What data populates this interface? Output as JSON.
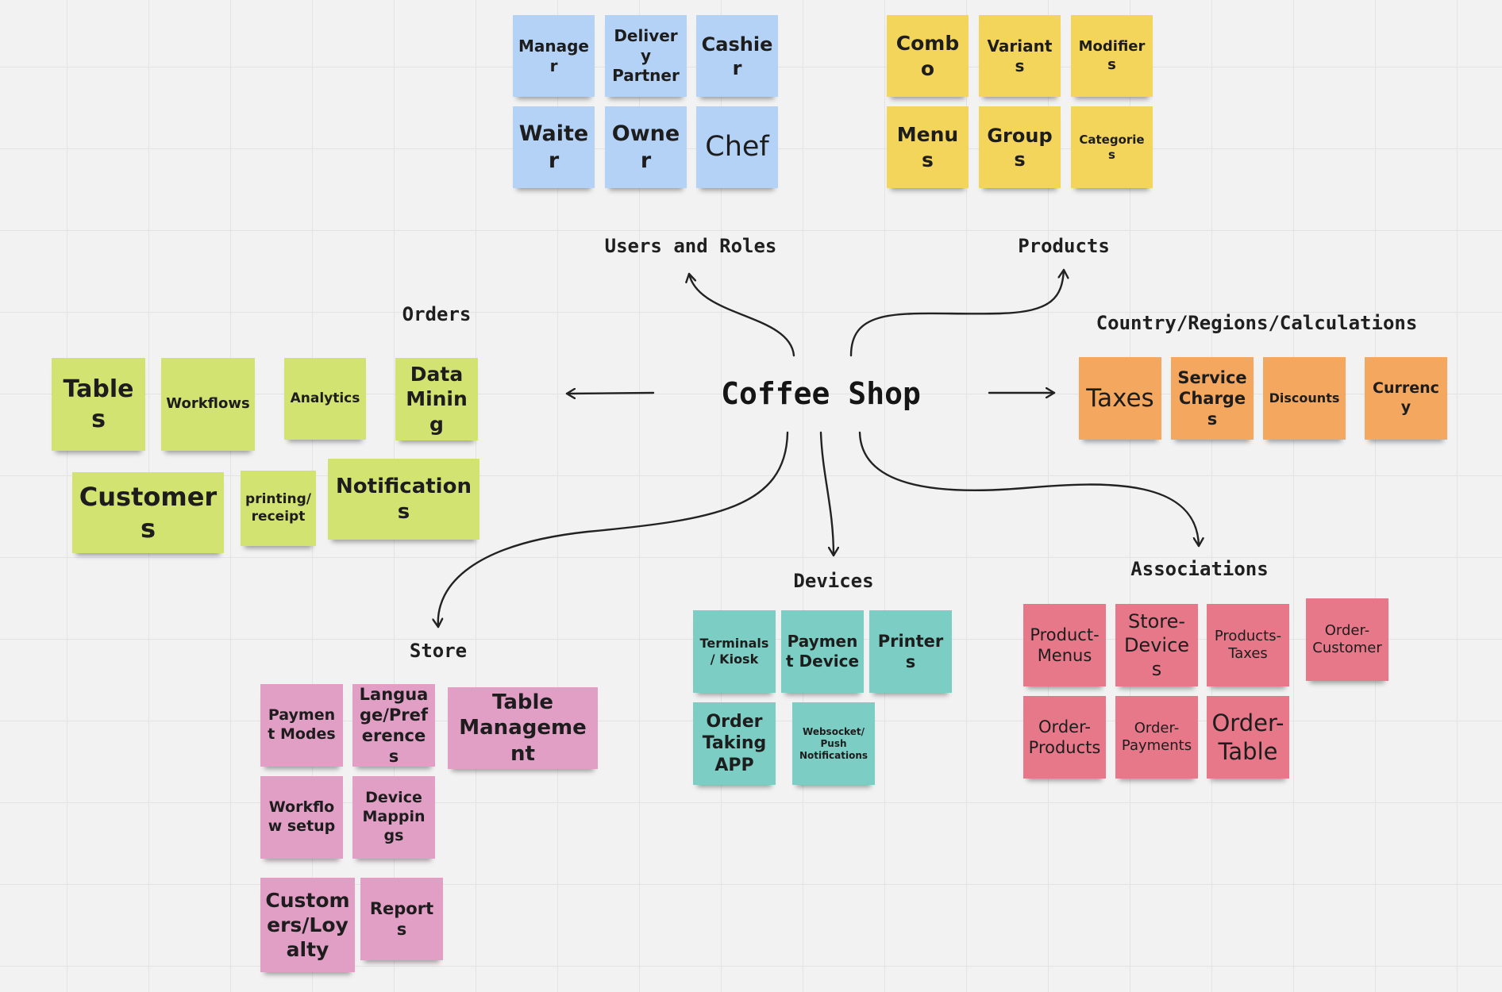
{
  "center": {
    "title": "Coffee Shop"
  },
  "groups": {
    "users_and_roles": {
      "label": "Users and Roles",
      "notes": [
        "Manager",
        "Delivery Partner",
        "Cashier",
        "Waiter",
        "Owner",
        "Chef"
      ]
    },
    "products": {
      "label": "Products",
      "notes": [
        "Combo",
        "Variants",
        "Modifiers",
        "Menus",
        "Groups",
        "Categories"
      ]
    },
    "orders": {
      "label": "Orders",
      "notes": [
        "Tables",
        "Workflows",
        "Analytics",
        "Data Mining",
        "Customers",
        "printing/ receipt",
        "Notifications"
      ]
    },
    "country": {
      "label": "Country/Regions/Calculations",
      "notes": [
        "Taxes",
        "Service Charges",
        "Discounts",
        "Currency"
      ]
    },
    "store": {
      "label": "Store",
      "notes": [
        "Payment Modes",
        "Langua ge/Pref erences",
        "Table Management",
        "Workflow setup",
        "Device Mappings",
        "Custom ers/Loy alty",
        "Reports"
      ]
    },
    "devices": {
      "label": "Devices",
      "notes": [
        "Terminals/ Kiosk",
        "Payment Device",
        "Printers",
        "Order Taking APP",
        "Websocket/ Push Notifications"
      ]
    },
    "associations": {
      "label": "Associations",
      "notes": [
        "Product-Menus",
        "Store-Devices",
        "Products-Taxes",
        "Order-Customer",
        "Order-Products",
        "Order-Payments",
        "Order-Table"
      ]
    }
  },
  "colors": {
    "blue": "#b4d2f6",
    "yellow": "#f3d55c",
    "green": "#d3e372",
    "orange": "#f3a75f",
    "teal": "#7ccdc4",
    "pink": "#e29fc6",
    "red": "#e6788a"
  }
}
